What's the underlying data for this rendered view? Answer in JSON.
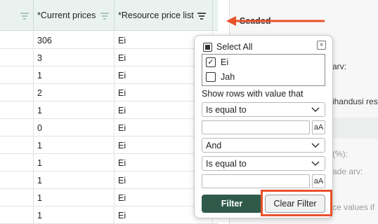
{
  "grid": {
    "columns": [
      {
        "label": ""
      },
      {
        "label": "*Current prices"
      },
      {
        "label": "*Resource price list"
      }
    ],
    "rows": [
      [
        "",
        "306",
        "Ei"
      ],
      [
        "",
        "3",
        "Ei"
      ],
      [
        "",
        "1",
        "Ei"
      ],
      [
        "",
        "2",
        "Ei"
      ],
      [
        "",
        "1",
        "Ei"
      ],
      [
        "",
        "0",
        "Ei"
      ],
      [
        "",
        "1",
        "Ei"
      ],
      [
        "",
        "1",
        "Ei"
      ],
      [
        "",
        "1",
        "Ei"
      ],
      [
        "",
        "1",
        "Ei"
      ],
      [
        "",
        "1",
        "Ei"
      ]
    ]
  },
  "right_panel": {
    "title": "Seaded",
    "labels": [
      "arv:",
      "ihandusi res",
      "(%):",
      "ade arv:",
      "ce values if"
    ]
  },
  "filter_popup": {
    "select_all_label": "Select All",
    "close_symbol": "×",
    "values": [
      {
        "label": "Ei",
        "checked": true
      },
      {
        "label": "Jah",
        "checked": false
      }
    ],
    "show_rows_label": "Show rows with value that",
    "condition1": "Is equal to",
    "value1": "",
    "match_case1": "aA",
    "join_operator": "And",
    "condition2": "Is equal to",
    "value2": "",
    "match_case2": "aA",
    "filter_button": "Filter",
    "clear_filter_button": "Clear Filter"
  },
  "colors": {
    "header_bg": "#e9f2ee",
    "primary_button": "#2f5a4a",
    "annotation": "#e8522a"
  },
  "icons": [
    "filter-icon",
    "active-filter-icon",
    "close-icon",
    "chevron-down-icon",
    "check-icon",
    "scroll-up-icon"
  ]
}
